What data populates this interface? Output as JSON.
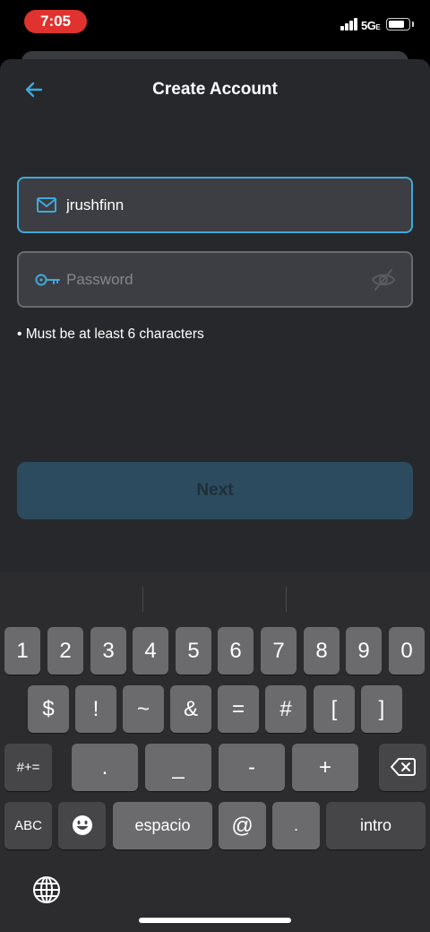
{
  "status_bar": {
    "time": "7:05",
    "network": "5G",
    "network_suffix": "E"
  },
  "header": {
    "title": "Create Account"
  },
  "form": {
    "email": {
      "value": "jrushfinn",
      "icon": "mail-icon"
    },
    "password": {
      "value": "",
      "placeholder": "Password",
      "icon": "key-icon",
      "toggle_icon": "eye-slash-icon"
    },
    "hint": "• Must be at least 6 characters",
    "next_label": "Next"
  },
  "colors": {
    "accent": "#3fa9d9",
    "background": "#27282c",
    "field": "#3d3e43",
    "next_button": "#2d4b5e",
    "time_pill": "#e0322e"
  },
  "keyboard": {
    "row1": [
      "1",
      "2",
      "3",
      "4",
      "5",
      "6",
      "7",
      "8",
      "9",
      "0"
    ],
    "row2": [
      "$",
      "!",
      "~",
      "&",
      "=",
      "#",
      "[",
      "]"
    ],
    "row3": [
      "#+=",
      ".",
      "_",
      "-",
      "+"
    ],
    "row4": [
      "ABC",
      "espacio",
      "@",
      ".",
      "intro"
    ]
  }
}
